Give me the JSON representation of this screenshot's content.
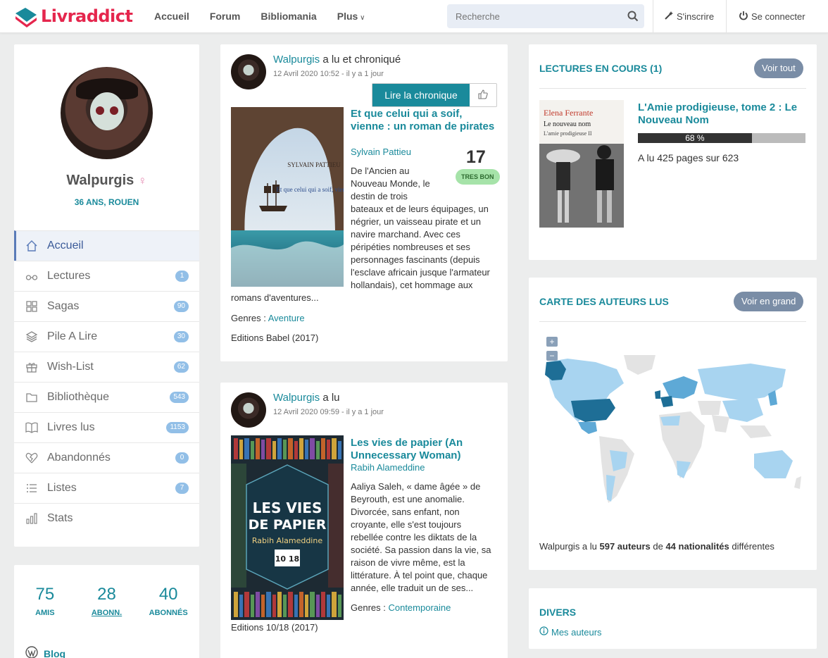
{
  "header": {
    "logo": "Livraddict",
    "nav": [
      "Accueil",
      "Forum",
      "Bibliomania",
      "Plus"
    ],
    "search_placeholder": "Recherche",
    "signup": "S'inscrire",
    "login": "Se connecter"
  },
  "profile": {
    "name": "Walpurgis",
    "info": "36 ANS, ROUEN",
    "menu": [
      {
        "label": "Accueil",
        "badge": ""
      },
      {
        "label": "Lectures",
        "badge": "1"
      },
      {
        "label": "Sagas",
        "badge": "90"
      },
      {
        "label": "Pile A Lire",
        "badge": "30"
      },
      {
        "label": "Wish-List",
        "badge": "62"
      },
      {
        "label": "Bibliothèque",
        "badge": "543"
      },
      {
        "label": "Livres lus",
        "badge": "1153"
      },
      {
        "label": "Abandonnés",
        "badge": "0"
      },
      {
        "label": "Listes",
        "badge": "7"
      },
      {
        "label": "Stats",
        "badge": ""
      }
    ]
  },
  "social": {
    "amis_num": "75",
    "amis_label": "AMIS",
    "abonn_num": "28",
    "abonn_label": "ABONN.",
    "abonnes_num": "40",
    "abonnes_label": "ABONNÉS",
    "blog": "Blog"
  },
  "posts": [
    {
      "user": "Walpurgis",
      "action": "a lu et chroniqué",
      "date": "12 Avril 2020 10:52 - il y a 1 jour",
      "button": "Lire la chronique",
      "title": "Et que celui qui a soif, vienne : un roman de pirates",
      "author": "Sylvain Pattieu",
      "rating": "17",
      "rating_label": "TRES BON",
      "blurb_narrow": [
        "De l'Ancien au",
        "Nouveau Monde, le",
        "destin de trois"
      ],
      "blurb_wide": [
        "bateaux et de leurs équipages, un",
        "négrier, un vaisseau pirate et un",
        "navire marchand. Avec ces",
        "péripéties nombreuses et ses",
        "personnages fascinants (depuis",
        "l'esclave africain jusque l'armateur",
        "hollandais), cet hommage aux"
      ],
      "blurb_full": "romans d'aventures...",
      "genres_label": "Genres : ",
      "genre": "Aventure",
      "edition": "Editions Babel (2017)",
      "cover_author": "SYLVAIN PATTIEU",
      "cover_title": "Et que celui qui a soif, vienne"
    },
    {
      "user": "Walpurgis",
      "action": "a lu",
      "date": "12 Avril 2020 09:59 - il y a 1 jour",
      "title": "Les vies de papier (An Unnecessary Woman)",
      "author": "Rabih Alameddine",
      "blurb": [
        "Aaliya Saleh, « dame âgée » de",
        "Beyrouth, est une anomalie.",
        "Divorcée, sans enfant, non",
        "croyante, elle s'est toujours",
        "rebellée contre les diktats de la",
        "société. Sa passion dans la vie, sa",
        "raison de vivre même, est la",
        "littérature. À tel point que, chaque",
        "année, elle traduit un de ses..."
      ],
      "genres_label": "Genres : ",
      "genre": "Contemporaine",
      "edition": "Editions 10/18 (2017)",
      "cover_line1": "LES VIES",
      "cover_line2": "DE PAPIER",
      "cover_author": "Rabih Alameddine",
      "cover_series": "10 18"
    }
  ],
  "reading": {
    "title": "LECTURES EN COURS (1)",
    "button": "Voir tout",
    "book_title": "L'Amie prodigieuse, tome 2 : Le Nouveau Nom",
    "progress": 0.68,
    "progress_label": "68 %",
    "pages": "A lu 425 pages sur 623",
    "cover_author": "Elena Ferrante",
    "cover_title": "Le nouveau nom",
    "cover_sub": "L'amie prodigieuse II"
  },
  "map": {
    "title": "CARTE DES AUTEURS LUS",
    "button": "Voir en grand",
    "zoom_in": "+",
    "zoom_out": "−",
    "summary_pre": "Walpurgis a lu ",
    "summary_authors": "597 auteurs",
    "summary_mid": " de ",
    "summary_nat": "44 nationalités",
    "summary_post": " différentes",
    "colors": {
      "dark": "#1e6e96",
      "mid": "#5ea9d6",
      "light": "#a8d4f0",
      "none": "#e3e3e3"
    }
  },
  "divers": {
    "title": "DIVERS",
    "link": "Mes auteurs"
  }
}
